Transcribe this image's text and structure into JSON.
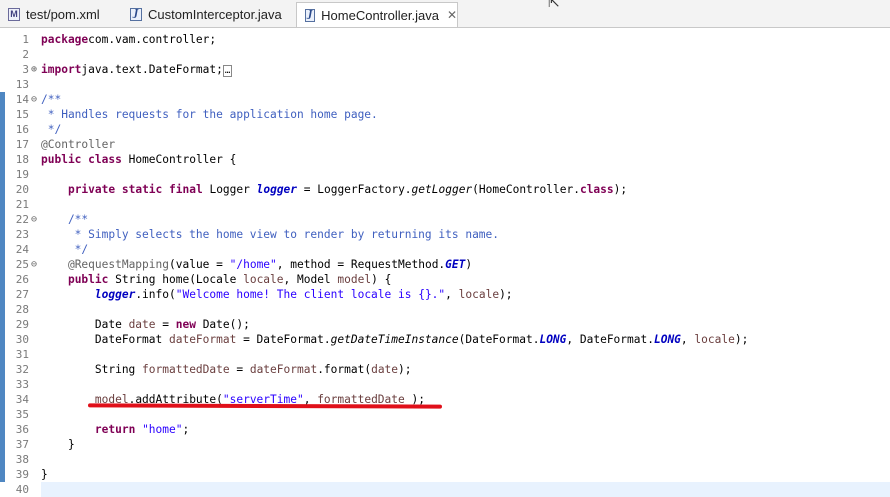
{
  "tabs": [
    {
      "label": "test/pom.xml",
      "icon": "xml-file-icon",
      "active": false
    },
    {
      "label": "CustomInterceptor.java",
      "icon": "java-file-icon",
      "active": false
    },
    {
      "label": "HomeController.java",
      "icon": "java-file-icon",
      "active": true,
      "close": "✕"
    }
  ],
  "lines": [
    {
      "n": "1",
      "fold": "",
      "bar": false,
      "spans": [
        [
          "kw",
          "package"
        ],
        [
          "",
          "com.vam.controller;"
        ]
      ]
    },
    {
      "n": "2",
      "fold": "",
      "bar": false,
      "spans": []
    },
    {
      "n": "3",
      "fold": "⊕",
      "bar": false,
      "spans": [
        [
          "kw",
          "import"
        ],
        [
          "",
          "java.text.DateFormat;"
        ],
        [
          "bx",
          "…"
        ]
      ]
    },
    {
      "n": "13",
      "fold": "",
      "bar": false,
      "spans": []
    },
    {
      "n": "14",
      "fold": "⊖",
      "bar": true,
      "spans": [
        [
          "cm",
          "/**"
        ]
      ]
    },
    {
      "n": "15",
      "fold": "",
      "bar": true,
      "spans": [
        [
          "cm",
          " * Handles requests for the application home page."
        ]
      ]
    },
    {
      "n": "16",
      "fold": "",
      "bar": true,
      "spans": [
        [
          "cm",
          " */"
        ]
      ]
    },
    {
      "n": "17",
      "fold": "",
      "bar": true,
      "spans": [
        [
          "an",
          "@Controller"
        ]
      ]
    },
    {
      "n": "18",
      "fold": "",
      "bar": true,
      "spans": [
        [
          "kw",
          "public"
        ],
        [
          "",
          " "
        ],
        [
          "kw",
          "class"
        ],
        [
          "",
          "",
          " HomeController {"
        ]
      ]
    },
    {
      "n": "19",
      "fold": "",
      "bar": true,
      "spans": []
    },
    {
      "n": "20",
      "fold": "",
      "bar": true,
      "spans": [
        [
          "",
          "    "
        ],
        [
          "kw",
          "private"
        ],
        [
          "",
          " "
        ],
        [
          "kw",
          "static"
        ],
        [
          "",
          " "
        ],
        [
          "kw",
          "final"
        ],
        [
          "",
          " Logger "
        ],
        [
          "sf",
          "logger"
        ],
        [
          "",
          " = LoggerFactory."
        ],
        [
          "it",
          "getLogger"
        ],
        [
          "",
          "(HomeController."
        ],
        [
          "kw",
          "class"
        ],
        [
          "",
          ");"
        ]
      ]
    },
    {
      "n": "21",
      "fold": "",
      "bar": true,
      "spans": []
    },
    {
      "n": "22",
      "fold": "⊖",
      "bar": true,
      "spans": [
        [
          "cm",
          "    /**"
        ]
      ]
    },
    {
      "n": "23",
      "fold": "",
      "bar": true,
      "spans": [
        [
          "cm",
          "     * Simply selects the home view to render by returning its name."
        ]
      ]
    },
    {
      "n": "24",
      "fold": "",
      "bar": true,
      "spans": [
        [
          "cm",
          "     */"
        ]
      ]
    },
    {
      "n": "25",
      "fold": "⊖",
      "bar": true,
      "spans": [
        [
          "",
          "    "
        ],
        [
          "an",
          "@RequestMapping"
        ],
        [
          "",
          "(value = "
        ],
        [
          "st",
          "\"/home\""
        ],
        [
          "",
          ", method = RequestMethod."
        ],
        [
          "sf",
          "GET"
        ],
        [
          "",
          ")"
        ]
      ]
    },
    {
      "n": "26",
      "fold": "",
      "bar": true,
      "spans": [
        [
          "",
          "    "
        ],
        [
          "kw",
          "public"
        ],
        [
          "",
          " String home(Locale "
        ],
        [
          "lv",
          "locale"
        ],
        [
          "",
          ", Model "
        ],
        [
          "lv",
          "model"
        ],
        [
          "",
          ") {"
        ]
      ]
    },
    {
      "n": "27",
      "fold": "",
      "bar": true,
      "spans": [
        [
          "",
          "        "
        ],
        [
          "sf",
          "logger"
        ],
        [
          "",
          ".info("
        ],
        [
          "st",
          "\"Welcome home! The client locale is {}.\""
        ],
        [
          "",
          ", "
        ],
        [
          "lv",
          "locale"
        ],
        [
          "",
          ");"
        ]
      ]
    },
    {
      "n": "28",
      "fold": "",
      "bar": true,
      "spans": []
    },
    {
      "n": "29",
      "fold": "",
      "bar": true,
      "spans": [
        [
          "",
          "        Date "
        ],
        [
          "lv",
          "date"
        ],
        [
          "",
          " = "
        ],
        [
          "kw",
          "new"
        ],
        [
          "",
          " Date();"
        ]
      ]
    },
    {
      "n": "30",
      "fold": "",
      "bar": true,
      "spans": [
        [
          "",
          "        DateFormat "
        ],
        [
          "lv",
          "dateFormat"
        ],
        [
          "",
          " = DateFormat."
        ],
        [
          "it",
          "getDateTimeInstance"
        ],
        [
          "",
          "(DateFormat."
        ],
        [
          "sf",
          "LONG"
        ],
        [
          "",
          ", DateFormat."
        ],
        [
          "sf",
          "LONG"
        ],
        [
          "",
          ", "
        ],
        [
          "lv",
          "locale"
        ],
        [
          "",
          ");"
        ]
      ]
    },
    {
      "n": "31",
      "fold": "",
      "bar": true,
      "spans": []
    },
    {
      "n": "32",
      "fold": "",
      "bar": true,
      "spans": [
        [
          "",
          "        String "
        ],
        [
          "lv",
          "formattedDate"
        ],
        [
          "",
          " = "
        ],
        [
          "lv",
          "dateFormat"
        ],
        [
          "",
          ".format("
        ],
        [
          "lv",
          "date"
        ],
        [
          "",
          ");"
        ]
      ]
    },
    {
      "n": "33",
      "fold": "",
      "bar": true,
      "spans": []
    },
    {
      "n": "34",
      "fold": "",
      "bar": true,
      "spans": [
        [
          "",
          "        "
        ],
        [
          "lv",
          "model"
        ],
        [
          "",
          ".addAttribute("
        ],
        [
          "st",
          "\"serverTime\""
        ],
        [
          "",
          ", "
        ],
        [
          "lv",
          "formattedDate"
        ],
        [
          "",
          " );"
        ]
      ]
    },
    {
      "n": "35",
      "fold": "",
      "bar": true,
      "spans": []
    },
    {
      "n": "36",
      "fold": "",
      "bar": true,
      "spans": [
        [
          "",
          "        "
        ],
        [
          "kw",
          "return"
        ],
        [
          "",
          " "
        ],
        [
          "st",
          "\"home\""
        ],
        [
          "",
          ";"
        ]
      ]
    },
    {
      "n": "37",
      "fold": "",
      "bar": true,
      "spans": [
        [
          "",
          "    }"
        ]
      ]
    },
    {
      "n": "38",
      "fold": "",
      "bar": true,
      "spans": []
    },
    {
      "n": "39",
      "fold": "",
      "bar": true,
      "spans": [
        [
          "",
          "}"
        ]
      ]
    },
    {
      "n": "40",
      "fold": "",
      "bar": false,
      "current": true,
      "spans": []
    }
  ],
  "colors": {
    "keyword": "#7f0055",
    "comment": "#3f5fbf",
    "string": "#2a00ff",
    "annotation": "#646464",
    "static_field": "#0000c0",
    "change_bar": "#4f87c2",
    "highlight_underline": "#e0101a"
  }
}
